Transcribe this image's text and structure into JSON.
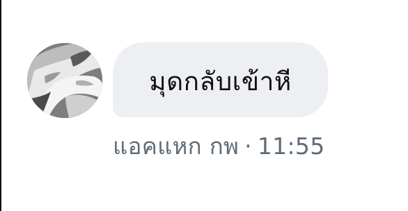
{
  "message": {
    "text": "มุดกลับเข้าหี",
    "sender": "แอคแหก กพ",
    "separator": "·",
    "time": "11:55"
  },
  "avatar": {
    "icon": "user-avatar-photo-grayscale"
  }
}
